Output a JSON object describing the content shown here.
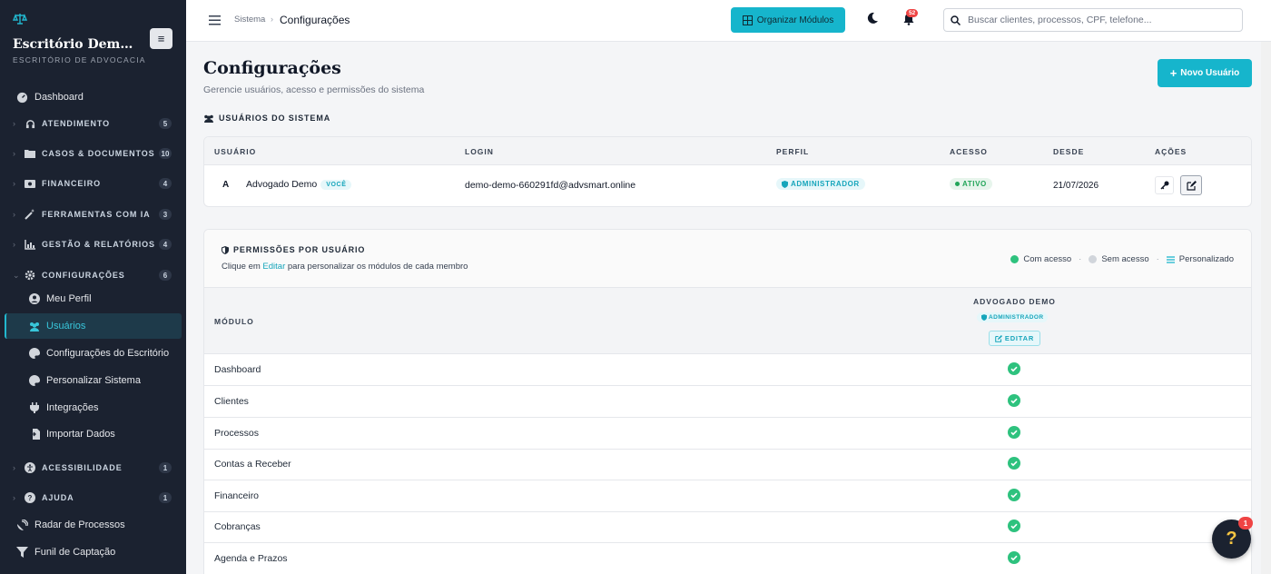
{
  "brand": {
    "name": "Escritório Dem…",
    "subtitle": "ESCRITÓRIO DE ADVOCACIA",
    "toggle_icon": "≡"
  },
  "nav": {
    "dashboard": "Dashboard",
    "atendimento": {
      "label": "ATENDIMENTO",
      "count": "5"
    },
    "casos": {
      "label": "CASOS & DOCUMENTOS",
      "count": "10"
    },
    "financeiro": {
      "label": "FINANCEIRO",
      "count": "4"
    },
    "ferramentas": {
      "label": "FERRAMENTAS COM IA",
      "count": "3"
    },
    "gestao": {
      "label": "GESTÃO & RELATÓRIOS",
      "count": "4"
    },
    "configuracoes": {
      "label": "CONFIGURAÇÕES",
      "count": "6"
    },
    "sub": [
      "Meu Perfil",
      "Usuários",
      "Configurações do Escritório",
      "Personalizar Sistema",
      "Integrações",
      "Importar Dados"
    ],
    "acessibilidade": {
      "label": "ACESSIBILIDADE",
      "count": "1"
    },
    "ajuda": {
      "label": "AJUDA",
      "count": "1"
    },
    "radar": "Radar de Processos",
    "funil": "Funil de Captação",
    "caret": "›"
  },
  "topbar": {
    "crumb_root": "Sistema",
    "crumb_sep": "›",
    "crumb_current": "Configurações",
    "organize_label": "Organizar Módulos",
    "notification_count": "52",
    "search_placeholder": "Buscar clientes, processos, CPF, telefone..."
  },
  "page": {
    "title": "Configurações",
    "subtitle": "Gerencie usuários, acesso e permissões do sistema",
    "new_user_label": "Novo Usuário",
    "new_user_plus": "+",
    "users_section": "USUÁRIOS DO SISTEMA"
  },
  "users_table": {
    "headers": [
      "USUÁRIO",
      "LOGIN",
      "PERFIL",
      "ACESSO",
      "DESDE",
      "AÇÕES"
    ],
    "rows": [
      {
        "avatar": "A",
        "name": "Advogado Demo",
        "you_badge": "VOCÊ",
        "login": "demo-demo-660291fd@advsmart.online",
        "profile": "ADMINISTRADOR",
        "access": "ATIVO",
        "since": "21/07/2026"
      }
    ]
  },
  "permissions": {
    "title": "PERMISSÕES POR USUÁRIO",
    "desc_prefix": "Clique em ",
    "desc_link": "Editar",
    "desc_suffix": " para personalizar os módulos de cada membro",
    "legend": {
      "with": "Com acesso",
      "without": "Sem acesso",
      "custom": "Personalizado",
      "sep": "·"
    },
    "module_header": "MÓDULO",
    "user_col": {
      "name": "ADVOGADO DEMO",
      "role": "ADMINISTRADOR",
      "edit": "EDITAR"
    },
    "modules": [
      "Dashboard",
      "Clientes",
      "Processos",
      "Contas a Receber",
      "Financeiro",
      "Cobranças",
      "Agenda e Prazos"
    ]
  },
  "help": {
    "label": "?",
    "badge": "1"
  },
  "colors": {
    "accent": "#16b5cc",
    "sidebar": "#1b2230",
    "success": "#2ec27e"
  }
}
